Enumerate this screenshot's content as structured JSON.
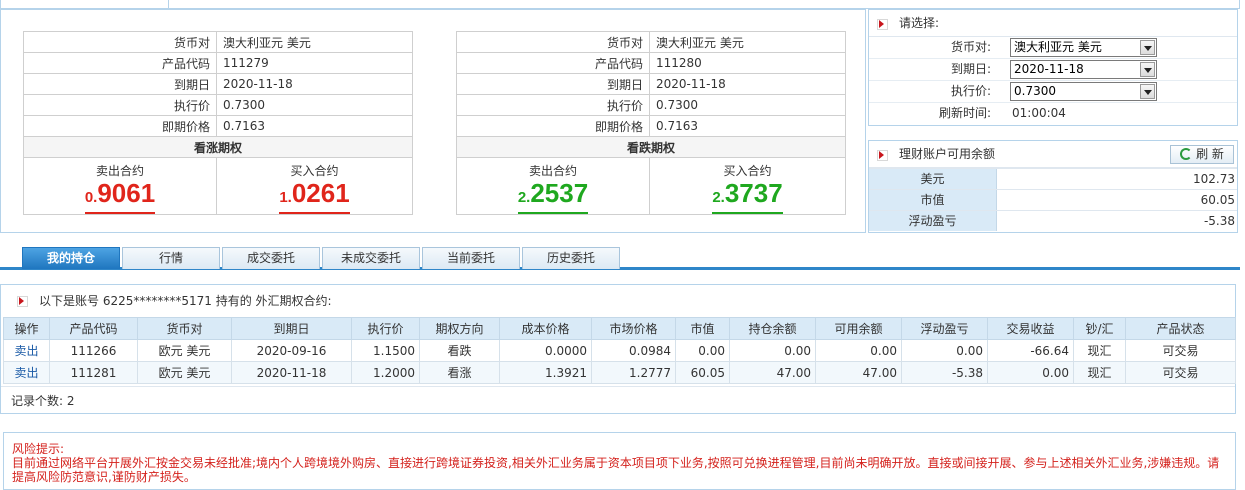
{
  "call_option": {
    "rows": [
      {
        "label": "货币对",
        "value": "澳大利亚元 美元"
      },
      {
        "label": "产品代码",
        "value": "111279"
      },
      {
        "label": "到期日",
        "value": "2020-11-18"
      },
      {
        "label": "执行价",
        "value": "0.7300"
      },
      {
        "label": "即期价格",
        "value": "0.7163"
      }
    ],
    "title": "看涨期权",
    "sell_label": "卖出合约",
    "sell_price_int": "0.",
    "sell_price_frac": "9061",
    "buy_label": "买入合约",
    "buy_price_int": "1.",
    "buy_price_frac": "0261",
    "price_color": "#e0251b"
  },
  "put_option": {
    "rows": [
      {
        "label": "货币对",
        "value": "澳大利亚元 美元"
      },
      {
        "label": "产品代码",
        "value": "111280"
      },
      {
        "label": "到期日",
        "value": "2020-11-18"
      },
      {
        "label": "执行价",
        "value": "0.7300"
      },
      {
        "label": "即期价格",
        "value": "0.7163"
      }
    ],
    "title": "看跌期权",
    "sell_label": "卖出合约",
    "sell_price_int": "2.",
    "sell_price_frac": "2537",
    "buy_label": "买入合约",
    "buy_price_int": "2.",
    "buy_price_frac": "3737",
    "price_color": "#1fa81f"
  },
  "selector": {
    "title": "请选择:",
    "currency_pair_label": "货币对:",
    "currency_pair_value": "澳大利亚元 美元",
    "expiry_label": "到期日:",
    "expiry_value": "2020-11-18",
    "strike_label": "执行价:",
    "strike_value": "0.7300",
    "refresh_time_label": "刷新时间:",
    "refresh_time_value": "01:00:04"
  },
  "balance": {
    "title": "理财账户可用余额",
    "refresh_label": "刷 新",
    "rows": [
      {
        "label": "美元",
        "value": "102.73"
      },
      {
        "label": "市值",
        "value": "60.05"
      },
      {
        "label": "浮动盈亏",
        "value": "-5.38"
      }
    ]
  },
  "tabs": [
    {
      "label": "我的持仓",
      "active": true
    },
    {
      "label": "行情",
      "active": false
    },
    {
      "label": "成交委托",
      "active": false
    },
    {
      "label": "未成交委托",
      "active": false
    },
    {
      "label": "当前委托",
      "active": false
    },
    {
      "label": "历史委托",
      "active": false
    }
  ],
  "holdings": {
    "heading": "以下是账号 6225********5171 持有的 外汇期权合约:",
    "columns": [
      "操作",
      "产品代码",
      "货币对",
      "到期日",
      "执行价",
      "期权方向",
      "成本价格",
      "市场价格",
      "市值",
      "持仓余额",
      "可用余额",
      "浮动盈亏",
      "交易收益",
      "钞/汇",
      "产品状态"
    ],
    "rows": [
      [
        "卖出",
        "111266",
        "欧元 美元",
        "2020-09-16",
        "1.1500",
        "看跌",
        "0.0000",
        "0.0984",
        "0.00",
        "0.00",
        "0.00",
        "0.00",
        "-66.64",
        "现汇",
        "可交易"
      ],
      [
        "卖出",
        "111281",
        "欧元 美元",
        "2020-11-18",
        "1.2000",
        "看涨",
        "1.3921",
        "1.2777",
        "60.05",
        "47.00",
        "47.00",
        "-5.38",
        "0.00",
        "现汇",
        "可交易"
      ]
    ],
    "record_count_label": "记录个数:  2"
  },
  "risk": {
    "title": "风险提示:",
    "text": "目前通过网络平台开展外汇按金交易未经批准;境内个人跨境境外购房、直接进行跨境证券投资,相关外汇业务属于资本项目项下业务,按照可兑换进程管理,目前尚未明确开放。直接或间接开展、参与上述相关外汇业务,涉嫌违规。请提高风险防范意识,谨防财产损失。"
  }
}
